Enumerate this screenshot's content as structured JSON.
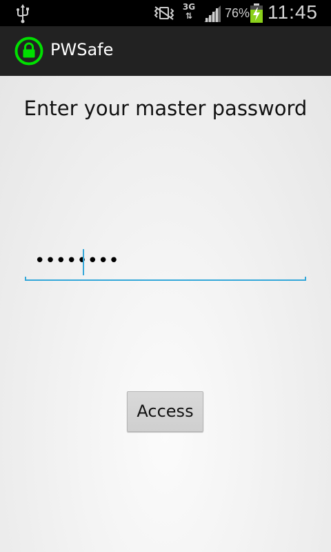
{
  "status_bar": {
    "network_type": "3G",
    "battery_percent": "76%",
    "time": "11:45",
    "icons": [
      "usb-icon",
      "vibrate-mute-icon",
      "network-3g-icon",
      "signal-icon",
      "battery-charging-icon"
    ]
  },
  "action_bar": {
    "app_icon": "lock-icon",
    "title": "PWSafe",
    "icon_color": "#00e000"
  },
  "main": {
    "prompt": "Enter your master password",
    "password": {
      "value": "••••••••",
      "accent_color": "#33a7d9"
    },
    "access_button_label": "Access"
  }
}
